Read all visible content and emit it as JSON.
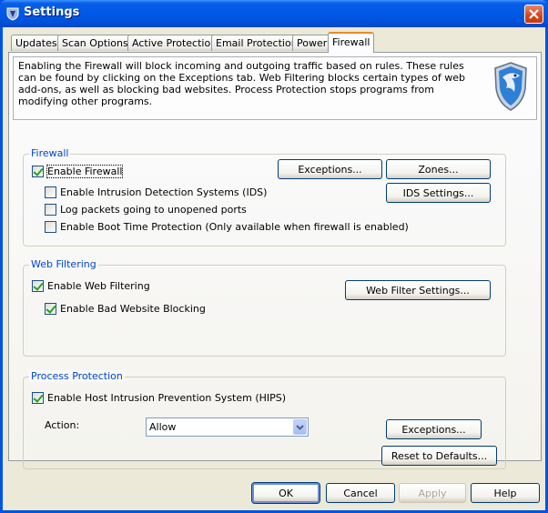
{
  "window": {
    "title": "Settings"
  },
  "tabs": [
    "Updates",
    "Scan Options",
    "Active Protection",
    "Email Protection",
    "Power",
    "Firewall"
  ],
  "active_tab": "Firewall",
  "intro": "Enabling the Firewall will block incoming and outgoing traffic based on rules. These rules can be found by clicking on the Exceptions tab. Web Filtering blocks certain types of web add-ons, as well as blocking bad websites. Process Protection stops programs from modifying other programs.",
  "firewall": {
    "title": "Firewall",
    "enable": {
      "label": "Enable Firewall",
      "checked": true
    },
    "ids": {
      "label": "Enable Intrusion Detection Systems (IDS)",
      "checked": false
    },
    "log": {
      "label": "Log packets going to unopened ports",
      "checked": false
    },
    "boot": {
      "label": "Enable Boot Time Protection (Only available when firewall is enabled)",
      "checked": false
    },
    "exceptions_button": "Exceptions...",
    "zones_button": "Zones...",
    "ids_settings_button": "IDS Settings..."
  },
  "web_filtering": {
    "title": "Web Filtering",
    "enable": {
      "label": "Enable Web Filtering",
      "checked": true
    },
    "bad_sites": {
      "label": "Enable Bad Website Blocking",
      "checked": true
    },
    "settings_button": "Web Filter Settings..."
  },
  "process_protection": {
    "title": "Process Protection",
    "hips": {
      "label": "Enable Host Intrusion Prevention System (HIPS)",
      "checked": true
    },
    "action_label": "Action:",
    "action_value": "Allow",
    "exceptions_button": "Exceptions..."
  },
  "reset_button": "Reset to Defaults...",
  "footer": {
    "ok": "OK",
    "cancel": "Cancel",
    "apply": "Apply",
    "help": "Help"
  }
}
